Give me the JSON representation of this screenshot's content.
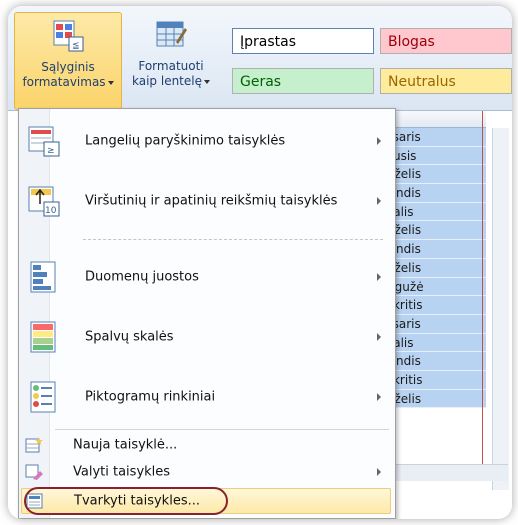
{
  "ribbon": {
    "conditional_formatting": {
      "line1": "Sąlyginis",
      "line2": "formatavimas"
    },
    "format_as_table": {
      "line1": "Formatuoti",
      "line2": "kaip lentelę"
    },
    "styles": {
      "normal": "Įprastas",
      "bad": "Blogas",
      "good": "Geras",
      "neutral": "Neutralus"
    }
  },
  "menu": {
    "items": [
      {
        "label": "Langelių paryškinimo taisyklės",
        "icon": "highlight-cells-rules-icon",
        "submenu": true
      },
      {
        "label": "Viršutinių ir apatinių reikšmių taisyklės",
        "icon": "top-bottom-rules-icon",
        "submenu": true
      },
      {
        "label": "Duomenų juostos",
        "icon": "data-bars-icon",
        "submenu": true
      },
      {
        "label": "Spalvų skalės",
        "icon": "color-scales-icon",
        "submenu": true
      },
      {
        "label": "Piktogramų rinkiniai",
        "icon": "icon-sets-icon",
        "submenu": true
      },
      {
        "label": "Nauja taisyklė...",
        "icon": "new-rule-icon",
        "submenu": false
      },
      {
        "label": "Valyti taisykles",
        "icon": "clear-rules-icon",
        "submenu": true
      },
      {
        "label": "Tvarkyti taisykles...",
        "icon": "manage-rules-icon",
        "submenu": false,
        "highlighted": true
      }
    ]
  },
  "sheet": {
    "cells": [
      "Vasaris",
      "Sausis",
      "Birželis",
      "alandis",
      "Spalis",
      "Birželis",
      "alandis",
      "Birželis",
      "Gegužė",
      "apkritis",
      "Vasaris",
      "Spalis",
      "alandis",
      "apkritis",
      "Birželis"
    ]
  },
  "colors": {
    "highlight": "#fde9a8",
    "selected_cells": "#b8d3f1",
    "annotation": "#8a2030"
  }
}
